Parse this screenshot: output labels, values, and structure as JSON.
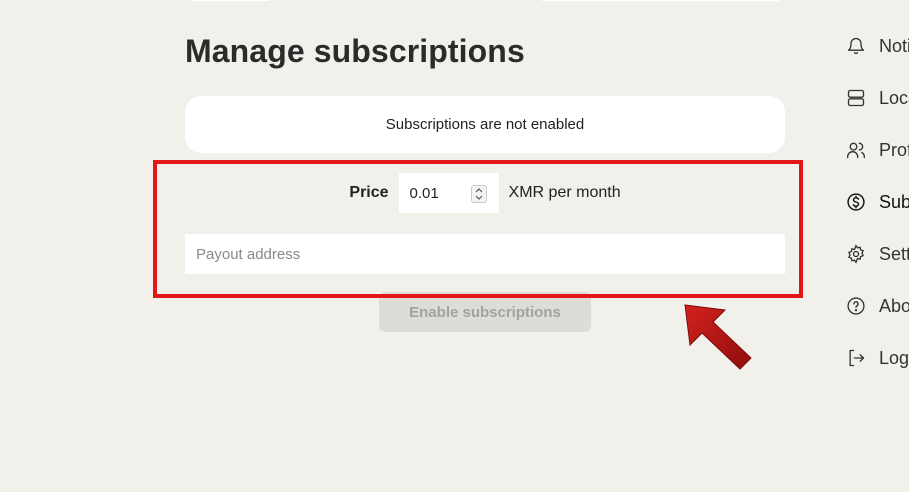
{
  "page": {
    "title": "Manage subscriptions",
    "notice": "Subscriptions are not enabled"
  },
  "price": {
    "label": "Price",
    "value": "0.01",
    "unit": "XMR per month"
  },
  "payout": {
    "placeholder": "Payout address"
  },
  "enable_button": {
    "label": "Enable subscriptions",
    "disabled": true
  },
  "sidebar": {
    "items": [
      {
        "label": "Noti",
        "icon": "bell-icon"
      },
      {
        "label": "Loca",
        "icon": "server-icon"
      },
      {
        "label": "Prof",
        "icon": "users-icon"
      },
      {
        "label": "Sub",
        "icon": "dollar-circle-icon",
        "active": true
      },
      {
        "label": "Sett",
        "icon": "gear-icon"
      },
      {
        "label": "Abo",
        "icon": "help-circle-icon"
      },
      {
        "label": "Logo",
        "icon": "logout-icon"
      }
    ]
  },
  "annotation": {
    "highlight_color": "#e3161a",
    "arrow_color": "#b3120f"
  }
}
